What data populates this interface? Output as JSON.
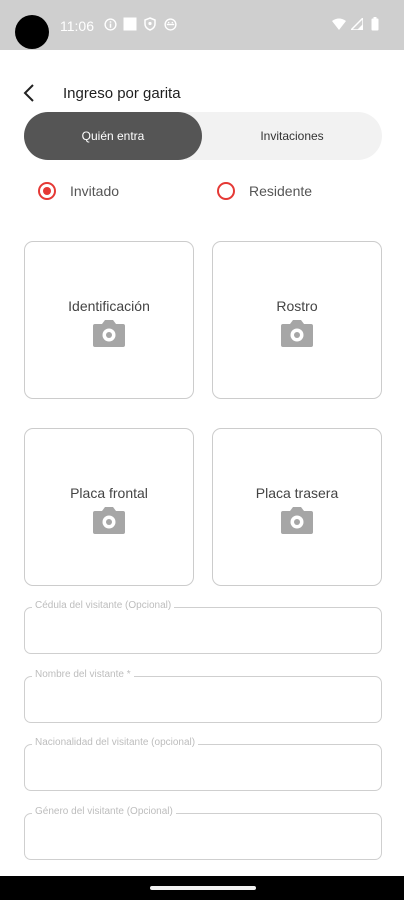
{
  "status_bar": {
    "time": "11:06",
    "left_icons": [
      "info-icon",
      "square-icon",
      "location-icon",
      "face-icon"
    ],
    "right_icons": [
      "wifi-icon",
      "signal-icon",
      "battery-icon"
    ]
  },
  "header": {
    "title": "Ingreso por garita"
  },
  "tabs": {
    "active": "Quién entra",
    "inactive": "Invitaciones"
  },
  "visitor_type": {
    "options": [
      "Invitado",
      "Residente"
    ],
    "selected": "Invitado"
  },
  "photo_cards": [
    {
      "label": "Identificación"
    },
    {
      "label": "Rostro"
    },
    {
      "label": "Placa frontal"
    },
    {
      "label": "Placa trasera"
    }
  ],
  "form": {
    "fields": [
      {
        "label": "Cédula del visitante (Opcional)",
        "value": ""
      },
      {
        "label": "Nombre del vistante *",
        "value": ""
      },
      {
        "label": "Nacionalidad del visitante (opcional)",
        "value": ""
      },
      {
        "label": "Género del visitante (Opcional)",
        "value": ""
      }
    ]
  },
  "colors": {
    "accent": "#e53935",
    "active_tab": "#555555",
    "tab_bg": "#f2f2f2",
    "status_bar": "#cfcfcf"
  }
}
